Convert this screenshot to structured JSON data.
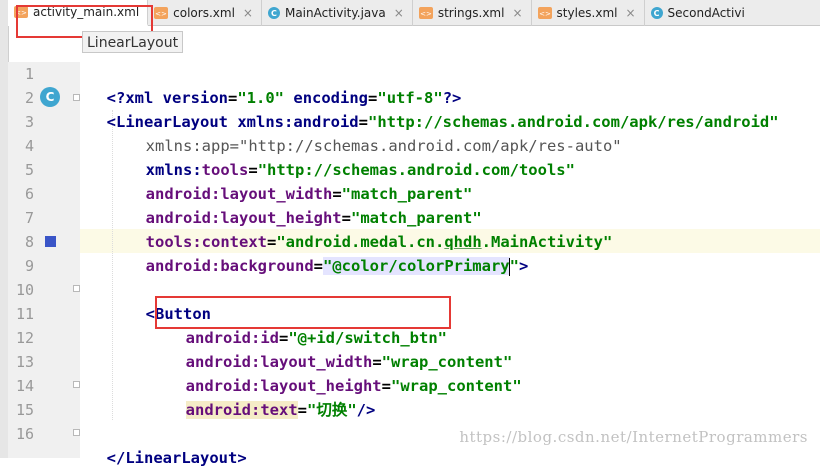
{
  "tabs": [
    {
      "label": "activity_main.xml",
      "icon": "xml-file-icon",
      "active": true
    },
    {
      "label": "colors.xml",
      "icon": "xml-file-icon"
    },
    {
      "label": "MainActivity.java",
      "icon": "class-file-icon"
    },
    {
      "label": "strings.xml",
      "icon": "xml-file-icon"
    },
    {
      "label": "styles.xml",
      "icon": "xml-file-icon"
    },
    {
      "label": "SecondActivi",
      "icon": "class-file-icon"
    }
  ],
  "close_glyph": "×",
  "breadcrumb": "LinearLayout",
  "gutter_marker_c": "C",
  "line_numbers": [
    "1",
    "2",
    "3",
    "4",
    "5",
    "6",
    "7",
    "8",
    "9",
    "10",
    "11",
    "12",
    "13",
    "14",
    "15",
    "16"
  ],
  "code": {
    "l1": {
      "a": "<?xml ",
      "b": "version",
      "c": "=",
      "d": "\"1.0\"",
      "e": " ",
      "f": "encoding",
      "g": "=",
      "h": "\"utf-8\"",
      "i": "?>"
    },
    "l2": {
      "a": "<LinearLayout ",
      "b": "xmlns:android",
      "c": "=",
      "d": "\"http://schemas.android.com/apk/res/android\""
    },
    "l3": {
      "a": "xmlns:app",
      "b": "=",
      "c": "\"http://schemas.android.com/apk/res-auto\""
    },
    "l4": {
      "a": "xmlns:",
      "b": "tools",
      "c": "=",
      "d": "\"http://schemas.android.com/tools\""
    },
    "l5": {
      "a": "android:",
      "b": "layout_width",
      "c": "=",
      "d": "\"match_parent\""
    },
    "l6": {
      "a": "android:",
      "b": "layout_height",
      "c": "=",
      "d": "\"match_parent\""
    },
    "l7": {
      "a": "tools:",
      "b": "context",
      "c": "=",
      "d": "\"android.medal.cn.",
      "e": "qhdh",
      "f": ".MainActivity\""
    },
    "l8": {
      "a": "android:",
      "b": "background",
      "c": "=",
      "d": "\"@color/colorPrimary",
      "e": "\"",
      "f": ">"
    },
    "l10": {
      "a": "<Button"
    },
    "l11": {
      "a": "android:",
      "b": "id",
      "c": "=",
      "d": "\"@+id/switch_btn\""
    },
    "l12": {
      "a": "android:",
      "b": "layout_width",
      "c": "=",
      "d": "\"wrap_content\""
    },
    "l13": {
      "a": "android:",
      "b": "layout_height",
      "c": "=",
      "d": "\"wrap_content\""
    },
    "l14": {
      "a": "android:",
      "b": "text",
      "c": "=",
      "d": "\"切换\"",
      "e": "/>"
    },
    "l16": {
      "a": "</LinearLayout>"
    }
  },
  "watermark": "https://blog.csdn.net/InternetProgrammers",
  "colors": {
    "tag": "#000080",
    "attribute": "#660e7a",
    "value": "#008000",
    "highlight_box": "#e53935",
    "current_line": "#fcfae6"
  }
}
